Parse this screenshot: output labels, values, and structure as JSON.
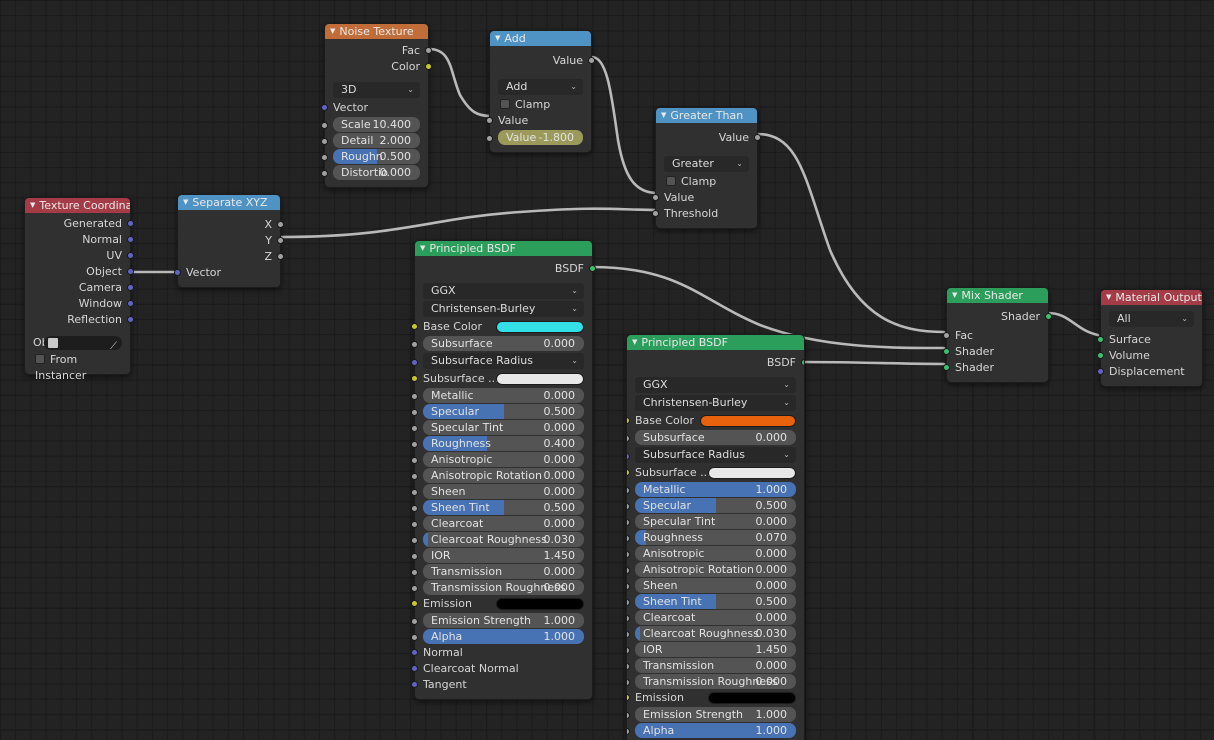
{
  "app": {
    "editor": "Shader Node Editor"
  },
  "nodes": {
    "texture_coordinate": {
      "title": "Texture Coordinate",
      "outputs": [
        "Generated",
        "Normal",
        "UV",
        "Object",
        "Camera",
        "Window",
        "Reflection"
      ],
      "object_label": "Objec",
      "object_value": "",
      "from_instancer_label": "From Instancer"
    },
    "separate_xyz": {
      "title": "Separate XYZ",
      "outputs": [
        "X",
        "Y",
        "Z"
      ],
      "inputs": [
        "Vector"
      ]
    },
    "noise_texture": {
      "title": "Noise Texture",
      "outputs": [
        "Fac",
        "Color"
      ],
      "dimension": "3D",
      "vector_label": "Vector",
      "props": [
        {
          "label": "Scale",
          "value": "10.400",
          "fill": 0
        },
        {
          "label": "Detail",
          "value": "2.000",
          "fill": 0
        },
        {
          "label": "Roughn",
          "value": "0.500",
          "fill": 50
        },
        {
          "label": "Distortio",
          "value": "0.000",
          "fill": 0
        }
      ]
    },
    "add_math": {
      "title": "Add",
      "outputs": [
        "Value"
      ],
      "operation": "Add",
      "clamp_label": "Clamp",
      "input_label": "Value",
      "value_field": {
        "label": "Value",
        "value": "-1.800"
      }
    },
    "greater_than": {
      "title": "Greater Than",
      "outputs": [
        "Value"
      ],
      "operation": "Greater Than",
      "clamp_label": "Clamp",
      "inputs": [
        "Value",
        "Threshold"
      ]
    },
    "principled_bsdf_1": {
      "title": "Principled BSDF",
      "outputs": [
        "BSDF"
      ],
      "distribution": "GGX",
      "subsurface_method": "Christensen-Burley",
      "base_color_label": "Base Color",
      "base_color": "#33e0e8",
      "subsurface_color_label": "Subsurface ...",
      "subsurface_color": "#e8e8e8",
      "subsurface_radius_label": "Subsurface Radius",
      "emission_label": "Emission",
      "emission_color": "#000000",
      "props": [
        {
          "label": "Subsurface",
          "value": "0.000",
          "fill": 0
        },
        {
          "label": "Metallic",
          "value": "0.000",
          "fill": 0
        },
        {
          "label": "Specular",
          "value": "0.500",
          "fill": 50
        },
        {
          "label": "Specular Tint",
          "value": "0.000",
          "fill": 0
        },
        {
          "label": "Roughness",
          "value": "0.400",
          "fill": 40
        },
        {
          "label": "Anisotropic",
          "value": "0.000",
          "fill": 0
        },
        {
          "label": "Anisotropic Rotation",
          "value": "0.000",
          "fill": 0
        },
        {
          "label": "Sheen",
          "value": "0.000",
          "fill": 0
        },
        {
          "label": "Sheen Tint",
          "value": "0.500",
          "fill": 50
        },
        {
          "label": "Clearcoat",
          "value": "0.000",
          "fill": 0
        },
        {
          "label": "Clearcoat Roughness",
          "value": "0.030",
          "fill": 3
        },
        {
          "label": "IOR",
          "value": "1.450",
          "fill": 0
        },
        {
          "label": "Transmission",
          "value": "0.000",
          "fill": 0
        },
        {
          "label": "Transmission Roughness",
          "value": "0.000",
          "fill": 0
        }
      ],
      "props_after_emission": [
        {
          "label": "Emission Strength",
          "value": "1.000",
          "fill": 0
        },
        {
          "label": "Alpha",
          "value": "1.000",
          "fill": 100
        }
      ],
      "vector_inputs": [
        "Normal",
        "Clearcoat Normal",
        "Tangent"
      ]
    },
    "principled_bsdf_2": {
      "title": "Principled BSDF",
      "outputs": [
        "BSDF"
      ],
      "distribution": "GGX",
      "subsurface_method": "Christensen-Burley",
      "base_color_label": "Base Color",
      "base_color": "#e8610d",
      "subsurface_color_label": "Subsurface ...",
      "subsurface_color": "#e8e8e8",
      "subsurface_radius_label": "Subsurface Radius",
      "emission_label": "Emission",
      "emission_color": "#000000",
      "props": [
        {
          "label": "Subsurface",
          "value": "0.000",
          "fill": 0
        },
        {
          "label": "Metallic",
          "value": "1.000",
          "fill": 100
        },
        {
          "label": "Specular",
          "value": "0.500",
          "fill": 50
        },
        {
          "label": "Specular Tint",
          "value": "0.000",
          "fill": 0
        },
        {
          "label": "Roughness",
          "value": "0.070",
          "fill": 7
        },
        {
          "label": "Anisotropic",
          "value": "0.000",
          "fill": 0
        },
        {
          "label": "Anisotropic Rotation",
          "value": "0.000",
          "fill": 0
        },
        {
          "label": "Sheen",
          "value": "0.000",
          "fill": 0
        },
        {
          "label": "Sheen Tint",
          "value": "0.500",
          "fill": 50
        },
        {
          "label": "Clearcoat",
          "value": "0.000",
          "fill": 0
        },
        {
          "label": "Clearcoat Roughness",
          "value": "0.030",
          "fill": 3
        },
        {
          "label": "IOR",
          "value": "1.450",
          "fill": 0
        },
        {
          "label": "Transmission",
          "value": "0.000",
          "fill": 0
        },
        {
          "label": "Transmission Roughness",
          "value": "0.000",
          "fill": 0
        }
      ],
      "props_after_emission": [
        {
          "label": "Emission Strength",
          "value": "1.000",
          "fill": 0
        },
        {
          "label": "Alpha",
          "value": "1.000",
          "fill": 100
        }
      ]
    },
    "mix_shader": {
      "title": "Mix Shader",
      "outputs": [
        "Shader"
      ],
      "inputs": [
        "Fac",
        "Shader",
        "Shader"
      ]
    },
    "material_output": {
      "title": "Material Output",
      "target": "All",
      "inputs": [
        "Surface",
        "Volume",
        "Displacement"
      ]
    }
  },
  "icons": {
    "collapse": "▼",
    "chevron_down": "⌄",
    "eyedropper": "⟋"
  },
  "colors": {
    "header_texture": "#c06d3a",
    "header_converter": "#4f93c4",
    "header_input": "#a33c47",
    "header_shader": "#2b9e5c",
    "slider_fill": "#4772b3",
    "socket_shader": "#3ac06a",
    "socket_vector": "#6363c7",
    "socket_color": "#c7c729",
    "socket_value": "#a1a1a1",
    "wire": "#b4b4b4"
  }
}
